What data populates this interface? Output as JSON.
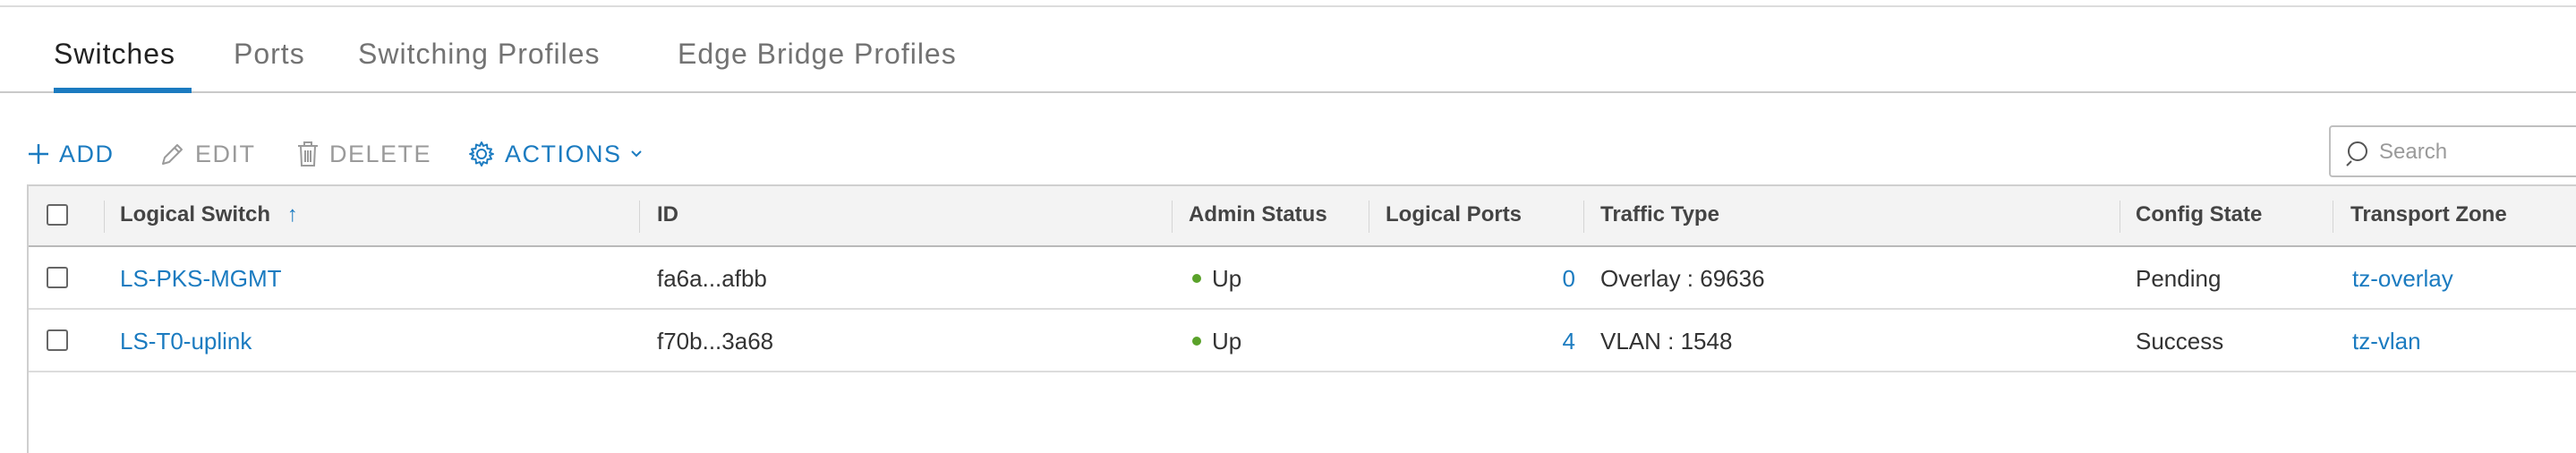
{
  "tabs": [
    {
      "label": "Switches",
      "active": true
    },
    {
      "label": "Ports",
      "active": false
    },
    {
      "label": "Switching Profiles",
      "active": false
    },
    {
      "label": "Edge Bridge Profiles",
      "active": false
    }
  ],
  "toolbar": {
    "add_label": "ADD",
    "edit_label": "EDIT",
    "delete_label": "DELETE",
    "actions_label": "ACTIONS"
  },
  "search": {
    "placeholder": "Search",
    "value": ""
  },
  "table": {
    "columns": [
      "Logical Switch",
      "ID",
      "Admin Status",
      "Logical Ports",
      "Traffic Type",
      "Config State",
      "Transport Zone"
    ],
    "sort_indicator": "↑",
    "rows": [
      {
        "name": "LS-PKS-MGMT",
        "id": "fa6a...afbb",
        "admin_status": "Up",
        "logical_ports": "0",
        "traffic_type": "Overlay : 69636",
        "config_state": "Pending",
        "transport_zone": "tz-overlay"
      },
      {
        "name": "LS-T0-uplink",
        "id": "f70b...3a68",
        "admin_status": "Up",
        "logical_ports": "4",
        "traffic_type": "VLAN : 1548",
        "config_state": "Success",
        "transport_zone": "tz-vlan"
      }
    ]
  },
  "colors": {
    "accent": "#1b7bc0",
    "status_up": "#5aa22a"
  }
}
